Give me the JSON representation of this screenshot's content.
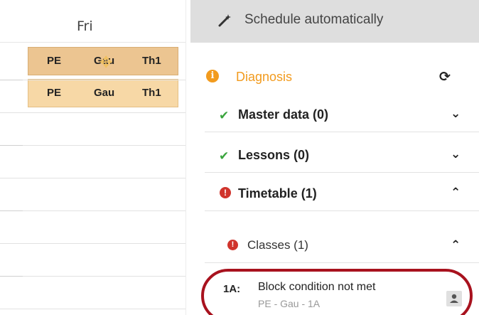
{
  "timetable": {
    "day": "Fri",
    "lessons": [
      {
        "subject": "PE",
        "teacher": "Gau",
        "room": "Th1",
        "state": "selected"
      },
      {
        "subject": "PE",
        "teacher": "Gau",
        "room": "Th1",
        "state": "normal"
      }
    ]
  },
  "panel": {
    "schedule_button": "Schedule automatically",
    "diagnosis": {
      "title": "Diagnosis",
      "sections": [
        {
          "label": "Master data (0)",
          "status": "ok",
          "expanded": false
        },
        {
          "label": "Lessons (0)",
          "status": "ok",
          "expanded": false
        },
        {
          "label": "Timetable (1)",
          "status": "error",
          "expanded": true
        }
      ],
      "subsection": {
        "label": "Classes (1)",
        "status": "error",
        "expanded": true
      },
      "item": {
        "prefix": "1A:",
        "title": "Block condition not met",
        "subtitle": "PE - Gau - 1A"
      }
    }
  },
  "colors": {
    "accent_orange": "#f29b1e",
    "ok_green": "#3aa43e",
    "error_red": "#d0342c",
    "lesson_fill": "#f7d8a6",
    "highlight_ring": "#a8121e"
  },
  "icons": {
    "schedule": "magic-wand-icon",
    "diagnosis": "info-circle-icon",
    "refresh": "refresh-icon",
    "ok": "check-icon",
    "error": "exclamation-circle-icon",
    "collapsed": "chevron-down-icon",
    "expanded": "chevron-up-icon",
    "assign": "person-icon"
  }
}
